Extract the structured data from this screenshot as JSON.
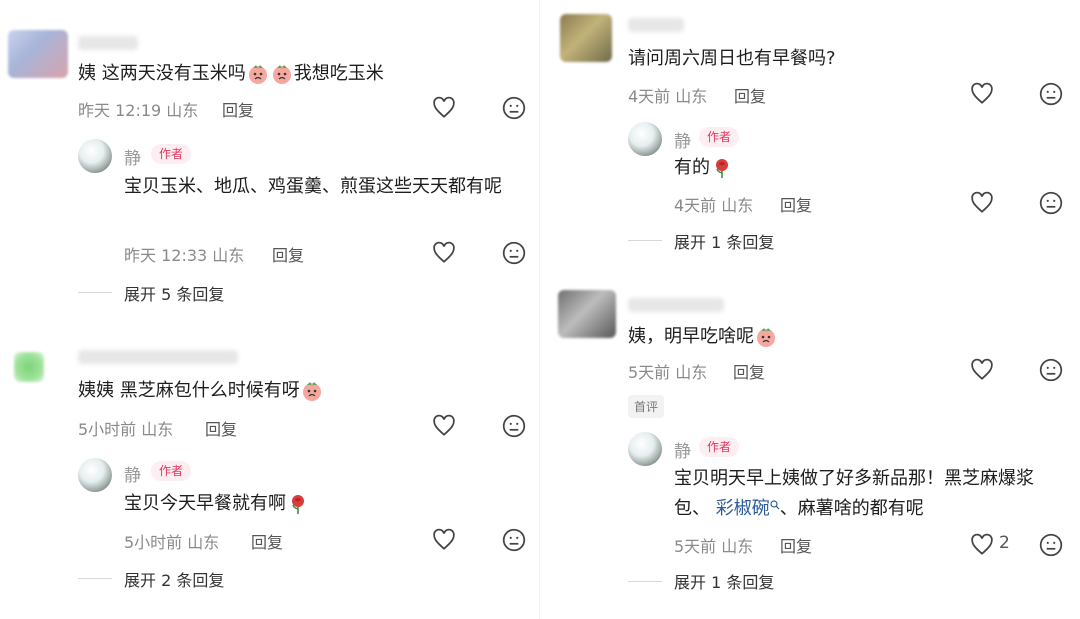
{
  "left": {
    "c1": {
      "text_a": "姨 这两天没有玉米吗",
      "text_b": "我想吃玉米",
      "time": "昨天 12:19",
      "location": "山东",
      "reply": "回复",
      "r1": {
        "name": "静",
        "tag": "作者",
        "text": "宝贝玉米、地瓜、鸡蛋羹、煎蛋这些天天都有呢",
        "time": "昨天 12:33",
        "location": "山东",
        "reply": "回复"
      },
      "expand": "展开 5 条回复"
    },
    "c2": {
      "text": "姨姨 黑芝麻包什么时候有呀",
      "time": "5小时前",
      "location": "山东",
      "reply": "回复",
      "r1": {
        "name": "静",
        "tag": "作者",
        "text": "宝贝今天早餐就有啊",
        "time": "5小时前",
        "location": "山东",
        "reply": "回复"
      },
      "expand": "展开 2 条回复"
    }
  },
  "right": {
    "c1": {
      "text": "请问周六周日也有早餐吗?",
      "time": "4天前",
      "location": "山东",
      "reply": "回复",
      "r1": {
        "name": "静",
        "tag": "作者",
        "text": "有的",
        "time": "4天前",
        "location": "山东",
        "reply": "回复"
      },
      "expand": "展开 1 条回复"
    },
    "c2": {
      "text": "姨，明早吃啥呢",
      "time": "5天前",
      "location": "山东",
      "reply": "回复",
      "badge": "首评",
      "r1": {
        "name": "静",
        "tag": "作者",
        "text_a": "宝贝明天早上姨做了好多新品那！黑芝麻爆浆",
        "text_b1": "包、",
        "link": "彩椒碗",
        "text_b2": "、麻薯啥的都有呢",
        "time": "5天前",
        "location": "山东",
        "reply": "回复",
        "likes": "2"
      },
      "expand": "展开 1 条回复"
    }
  },
  "icons": {
    "like": "heart-outline-icon",
    "dislike": "meh-face-icon",
    "search": "search-icon"
  }
}
